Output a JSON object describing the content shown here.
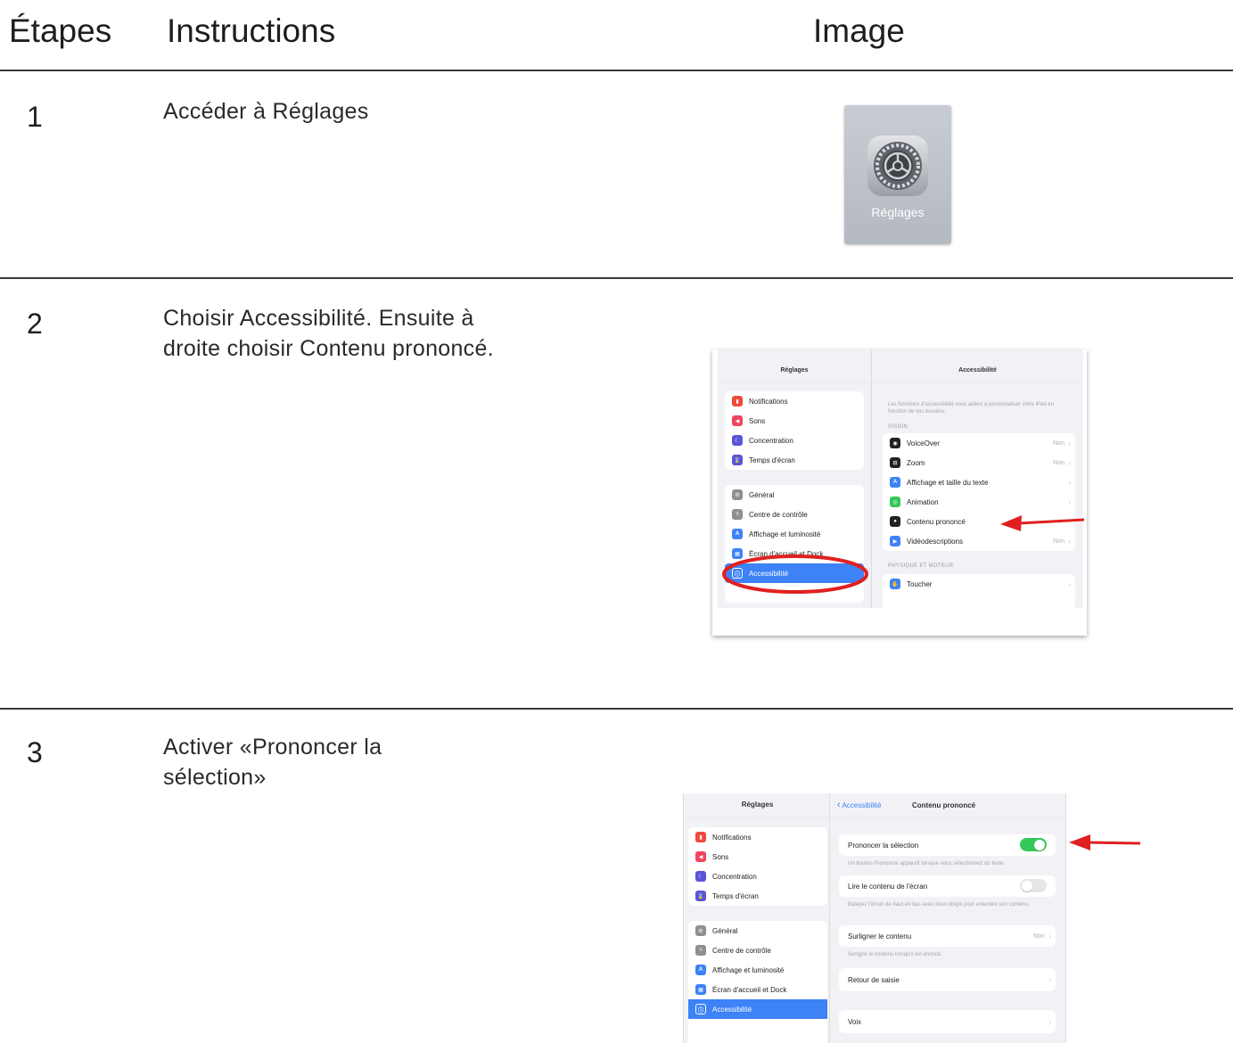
{
  "header": {
    "col_steps": "Étapes",
    "col_instructions": "Instructions",
    "col_image": "Image"
  },
  "steps": [
    {
      "number": "1",
      "text": "Accéder à Réglages"
    },
    {
      "number": "2",
      "text": "Choisir Accessibilité. Ensuite à droite choisir Contenu prononcé."
    },
    {
      "number": "3",
      "text": "Activer «Prononcer la sélection»"
    }
  ],
  "step1_image": {
    "app_label": "Réglages",
    "icon": "gear-icon"
  },
  "step2_image": {
    "left_title": "Réglages",
    "right_title": "Accessibilité",
    "left_group1": [
      {
        "label": "Notifications",
        "icon": "bell-icon",
        "color": "#f04a3d"
      },
      {
        "label": "Sons",
        "icon": "speaker-icon",
        "color": "#f0445e"
      },
      {
        "label": "Concentration",
        "icon": "moon-icon",
        "color": "#5a55d6"
      },
      {
        "label": "Temps d'écran",
        "icon": "hourglass-icon",
        "color": "#5a55d6"
      }
    ],
    "left_group2": [
      {
        "label": "Général",
        "icon": "gear-icon",
        "color": "#8e8e93"
      },
      {
        "label": "Centre de contrôle",
        "icon": "switches-icon",
        "color": "#8e8e93"
      },
      {
        "label": "Affichage et luminosité",
        "icon": "text-size-icon",
        "color": "#3d82f6"
      },
      {
        "label": "Écran d'accueil et Dock",
        "icon": "grid-icon",
        "color": "#3d82f6"
      },
      {
        "label": "Accessibilité",
        "icon": "accessibility-icon",
        "color": "#3d82f6",
        "selected": true
      }
    ],
    "intro": "Les fonctions d'accessibilité vous aident à personnaliser votre iPad en fonction de vos besoins.",
    "section_vision": "VISION",
    "vision_rows": [
      {
        "label": "VoiceOver",
        "value": "Non",
        "icon": "voiceover-icon",
        "color": "#222222"
      },
      {
        "label": "Zoom",
        "value": "Non",
        "icon": "zoom-icon",
        "color": "#222222"
      },
      {
        "label": "Affichage et taille du texte",
        "value": "",
        "icon": "text-size-icon",
        "color": "#3d82f6"
      },
      {
        "label": "Animation",
        "value": "",
        "icon": "animation-icon",
        "color": "#34c759"
      },
      {
        "label": "Contenu prononcé",
        "value": "",
        "icon": "speech-bubble-icon",
        "color": "#222222"
      },
      {
        "label": "Vidéodescriptions",
        "value": "Non",
        "icon": "video-description-icon",
        "color": "#3d82f6"
      }
    ],
    "section_physical": "PHYSIQUE ET MOTEUR",
    "physical_rows": [
      {
        "label": "Toucher",
        "value": "",
        "icon": "hand-icon",
        "color": "#3d82f6"
      }
    ],
    "annotation_color": "#e02020"
  },
  "step3_image": {
    "left_title": "Réglages",
    "back_label": "Accessibilité",
    "right_title": "Contenu prononcé",
    "left_group1": [
      {
        "label": "Notifications",
        "icon": "bell-icon",
        "color": "#f04a3d"
      },
      {
        "label": "Sons",
        "icon": "speaker-icon",
        "color": "#f0445e"
      },
      {
        "label": "Concentration",
        "icon": "moon-icon",
        "color": "#5a55d6"
      },
      {
        "label": "Temps d'écran",
        "icon": "hourglass-icon",
        "color": "#5a55d6"
      }
    ],
    "left_group2": [
      {
        "label": "Général",
        "icon": "gear-icon",
        "color": "#8e8e93"
      },
      {
        "label": "Centre de contrôle",
        "icon": "switches-icon",
        "color": "#8e8e93"
      },
      {
        "label": "Affichage et luminosité",
        "icon": "text-size-icon",
        "color": "#3d82f6"
      },
      {
        "label": "Écran d'accueil et Dock",
        "icon": "grid-icon",
        "color": "#3d82f6"
      },
      {
        "label": "Accessibilité",
        "icon": "accessibility-icon",
        "color": "#3d82f6",
        "selected": true
      }
    ],
    "speak_selection": {
      "label": "Prononcer la sélection",
      "on": true,
      "note": "Un bouton Prononcer apparaît lorsque vous sélectionnez du texte."
    },
    "speak_screen": {
      "label": "Lire le contenu de l'écran",
      "on": false,
      "note": "Balayez l'écran de haut en bas avec deux doigts pour entendre son contenu."
    },
    "highlight": {
      "label": "Surligner le contenu",
      "value": "Non",
      "note": "Surligne le contenu lorsqu'il est énoncé."
    },
    "typing_feedback": {
      "label": "Retour de saisie"
    },
    "voices": {
      "label": "Voix"
    },
    "annotation_color": "#e02020"
  }
}
